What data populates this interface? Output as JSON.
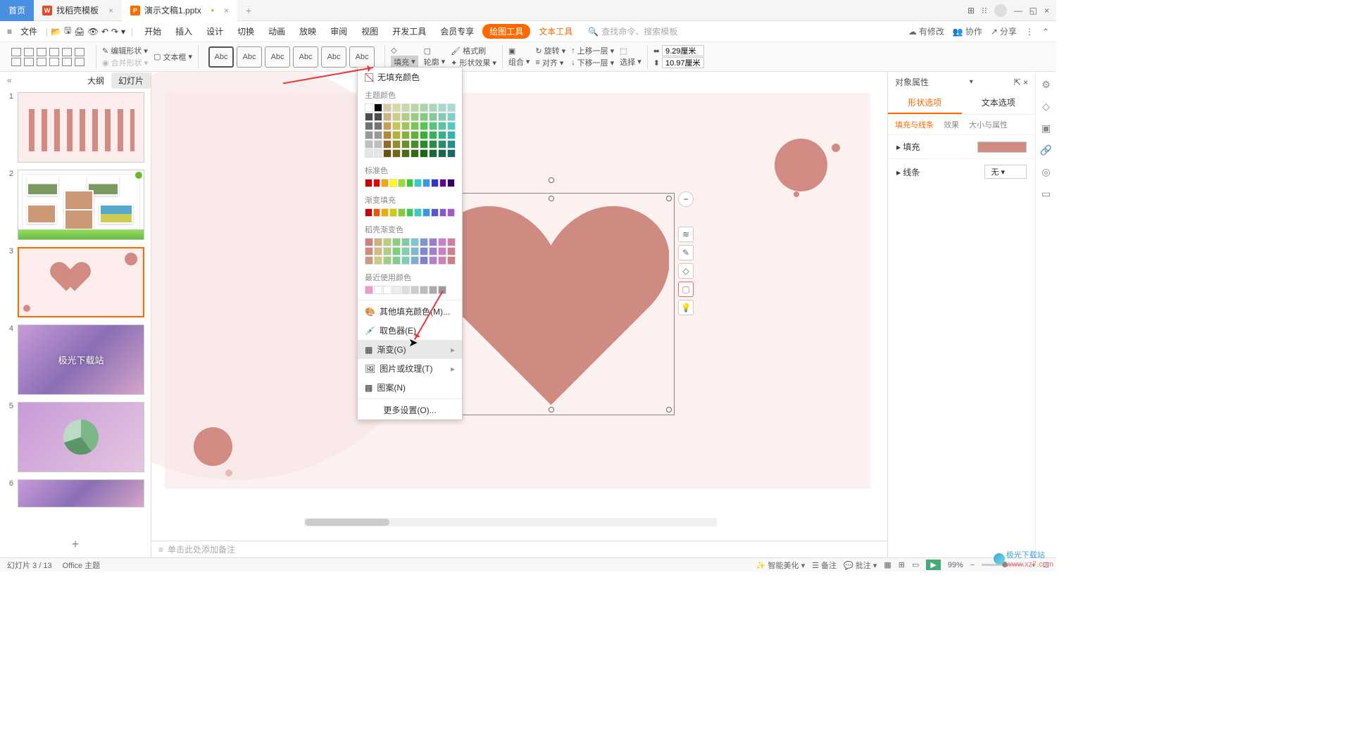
{
  "tabs": {
    "home": "首页",
    "t1": "找稻壳模板",
    "t2": "演示文稿1.pptx"
  },
  "menu": {
    "file": "文件",
    "items": [
      "开始",
      "插入",
      "设计",
      "切换",
      "动画",
      "放映",
      "审阅",
      "视图",
      "开发工具",
      "会员专享"
    ],
    "drawing_tools": "绘图工具",
    "text_tools": "文本工具",
    "search_ph": "查找命令、搜索模板",
    "pending": "有修改",
    "coop": "协作",
    "share": "分享"
  },
  "ribbon": {
    "edit_shape": "编辑形状",
    "text_box": "文本框",
    "merge": "合并形状",
    "abc": "Abc",
    "fill": "填充",
    "outline": "轮廓",
    "effects": "形状效果",
    "format_painter": "格式刷",
    "rotate": "旋转",
    "up": "上移一层",
    "align": "对齐",
    "down": "下移一层",
    "group": "组合",
    "select": "选择",
    "w": "9.29厘米",
    "h": "10.97厘米"
  },
  "slide_tabs": {
    "outline": "大纲",
    "slides": "幻灯片"
  },
  "scenic_text": "极光下载站",
  "popup": {
    "no_fill": "无填充颜色",
    "theme": "主题颜色",
    "standard": "标准色",
    "gradient_fill": "渐变填充",
    "shell_gradient": "稻壳渐变色",
    "recent": "最近使用颜色",
    "more_colors": "其他填充颜色(M)...",
    "eyedropper": "取色器(E)",
    "gradient": "渐变(G)",
    "picture": "图片或纹理(T)",
    "pattern": "图案(N)",
    "more": "更多设置(O)..."
  },
  "right": {
    "title": "对象属性",
    "tab1": "形状选项",
    "tab2": "文本选项",
    "sub1": "填充与线条",
    "sub2": "效果",
    "sub3": "大小与属性",
    "fill": "填充",
    "line": "线条",
    "line_none": "无"
  },
  "notes": "单击此处添加备注",
  "status": {
    "slide": "幻灯片 3 / 13",
    "theme": "Office 主题",
    "beautify": "智能美化",
    "notes": "备注",
    "comments": "批注",
    "zoom": "99%"
  },
  "watermark": {
    "brand": "极光下载站",
    "url": "www.xz7.com"
  }
}
